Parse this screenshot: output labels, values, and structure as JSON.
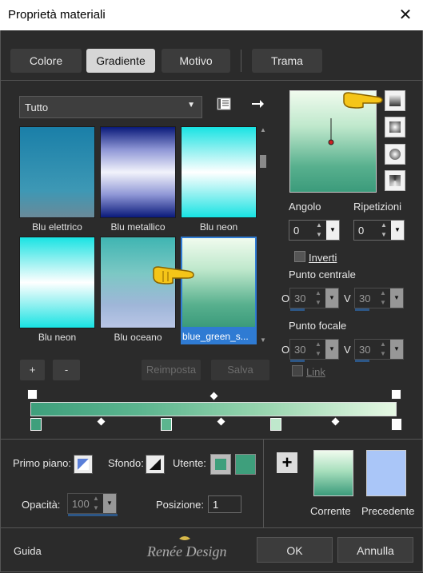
{
  "window": {
    "title": "Proprietà materiali",
    "close_icon": "close-icon"
  },
  "tabs": [
    {
      "label": "Colore",
      "active": false
    },
    {
      "label": "Gradiente",
      "active": true
    },
    {
      "label": "Motivo",
      "active": false
    },
    {
      "label": "Trama",
      "active": false
    }
  ],
  "category": {
    "value": "Tutto"
  },
  "gallery": {
    "items": [
      {
        "label": "Blu elettrico",
        "selected": false
      },
      {
        "label": "Blu metallico",
        "selected": false
      },
      {
        "label": "Blu neon",
        "selected": false
      },
      {
        "label": "Blu neon",
        "selected": false
      },
      {
        "label": "Blu oceano",
        "selected": false
      },
      {
        "label": "blue_green_s...",
        "selected": true
      }
    ]
  },
  "gallery_buttons": {
    "add": "+",
    "remove": "-",
    "reset": "Reimposta",
    "save": "Salva"
  },
  "angle": {
    "label": "Angolo",
    "value": "0"
  },
  "repeats": {
    "label": "Ripetizioni",
    "value": "0"
  },
  "invert": {
    "label": "Inverti",
    "checked": false
  },
  "center_point": {
    "label": "Punto centrale",
    "o_label": "O",
    "v_label": "V",
    "o_value": "30",
    "v_value": "30"
  },
  "focal_point": {
    "label": "Punto focale",
    "o_label": "O",
    "v_label": "V",
    "o_value": "30",
    "v_value": "30"
  },
  "link": {
    "label": "Link",
    "checked": false
  },
  "materials": {
    "foreground_label": "Primo piano:",
    "background_label": "Sfondo:",
    "user_label": "Utente:"
  },
  "opacity": {
    "label": "Opacità:",
    "value": "100"
  },
  "position": {
    "label": "Posizione:",
    "value": "1"
  },
  "swatches": {
    "current_label": "Corrente",
    "previous_label": "Precedente"
  },
  "footer": {
    "help": "Guida",
    "watermark": "Renée Design",
    "ok": "OK",
    "cancel": "Annulla"
  },
  "colors": {
    "accent": "#2f7bd3",
    "gradient_dark": "#3e9f7c",
    "gradient_light": "#e6f8e4",
    "previous": "#aac6f8"
  }
}
